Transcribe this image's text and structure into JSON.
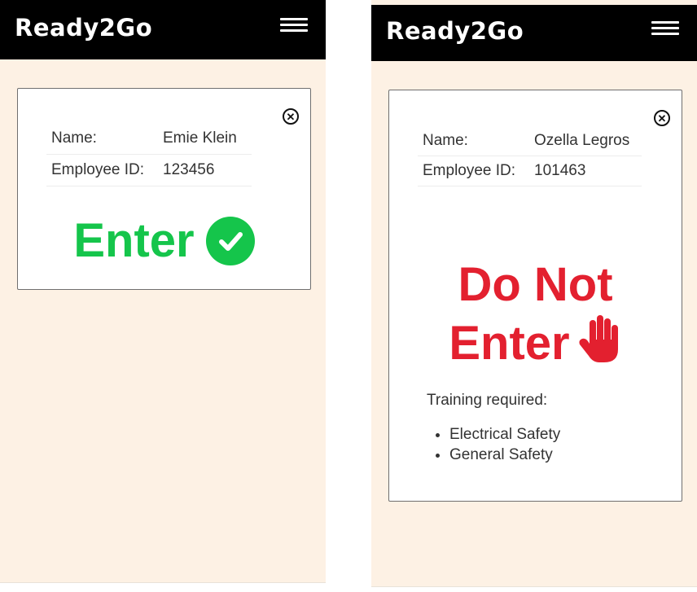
{
  "left_screen": {
    "app_title": "Ready2Go",
    "employee": {
      "name_label": "Name:",
      "name_value": "Emie Klein",
      "id_label": "Employee ID:",
      "id_value": "123456"
    },
    "status": {
      "text": "Enter",
      "color": "#15c54b",
      "icon": "check-circle-icon"
    }
  },
  "right_screen": {
    "app_title": "Ready2Go",
    "employee": {
      "name_label": "Name:",
      "name_value": "Ozella Legros",
      "id_label": "Employee ID:",
      "id_value": "101463"
    },
    "status": {
      "line1": "Do Not",
      "line2": "Enter",
      "color": "#e3202f",
      "icon": "stop-hand-icon"
    },
    "training": {
      "heading": "Training required:",
      "items": [
        "Electrical Safety",
        "General Safety"
      ]
    }
  },
  "colors": {
    "background": "#fdf1e4",
    "topbar": "#000000"
  }
}
